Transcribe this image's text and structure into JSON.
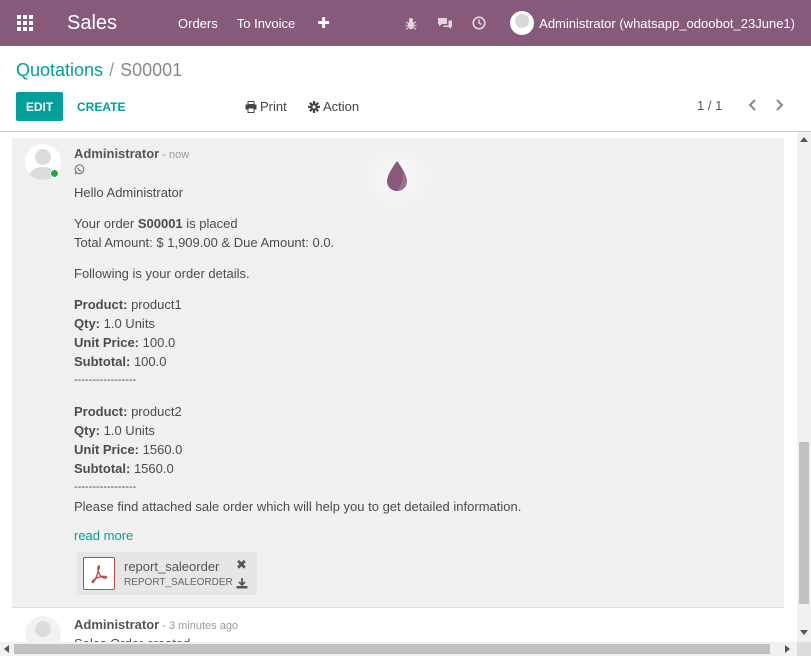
{
  "navbar": {
    "app_name": "Sales",
    "menu": [
      "Orders",
      "To Invoice"
    ],
    "plus": "✚",
    "user": "Administrator (whatsapp_odoobot_23June1)"
  },
  "breadcrumb": {
    "parent": "Quotations",
    "separator": "/",
    "current": "S00001"
  },
  "buttons": {
    "edit": "EDIT",
    "create": "CREATE",
    "print": "Print",
    "action": "Action"
  },
  "pager": {
    "value": "1 / 1"
  },
  "message": {
    "author": "Administrator",
    "date": "- now",
    "greeting": "Hello Administrator",
    "order_line_prefix": "Your order ",
    "order_ref": "S00001",
    "order_line_suffix": " is placed",
    "totals": "Total Amount: $ 1,909.00 & Due Amount: 0.0.",
    "details_intro": "Following is your order details.",
    "products": [
      {
        "product": "product1",
        "qty": "1.0 Units",
        "unit_price": "100.0",
        "subtotal": "100.0"
      },
      {
        "product": "product2",
        "qty": "1.0 Units",
        "unit_price": "1560.0",
        "subtotal": "1560.0"
      }
    ],
    "labels": {
      "product": "Product:",
      "qty": "Qty:",
      "unit_price": "Unit Price:",
      "subtotal": "Subtotal:"
    },
    "divider": "-----------------",
    "closing": "Please find attached sale order which will help you to get detailed information.",
    "read_more": "read more",
    "attachment": {
      "name": "report_saleorder",
      "ext": "REPORT_SALEORDER",
      "delete": "✖"
    }
  },
  "message2": {
    "author": "Administrator",
    "date": "- 3 minutes ago",
    "body": "Sales Order created"
  },
  "colors": {
    "brand": "#875a7b",
    "accent": "#00a09d"
  }
}
